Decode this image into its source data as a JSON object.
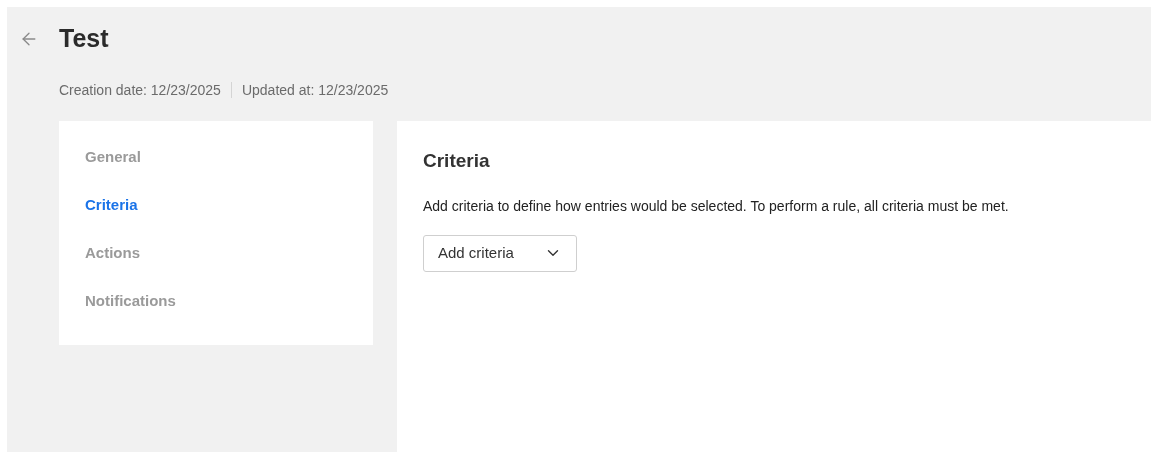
{
  "header": {
    "title": "Test",
    "creation_date": "Creation date: 12/23/2025",
    "updated_at": "Updated at: 12/23/2025"
  },
  "sidebar": {
    "items": [
      {
        "label": "General",
        "selected": false
      },
      {
        "label": "Criteria",
        "selected": true
      },
      {
        "label": "Actions",
        "selected": false
      },
      {
        "label": "Notifications",
        "selected": false
      }
    ]
  },
  "content": {
    "title": "Criteria",
    "description": "Add criteria to define how entries would be selected. To perform a rule, all criteria must be met.",
    "dropdown": {
      "label": "Add criteria"
    }
  }
}
